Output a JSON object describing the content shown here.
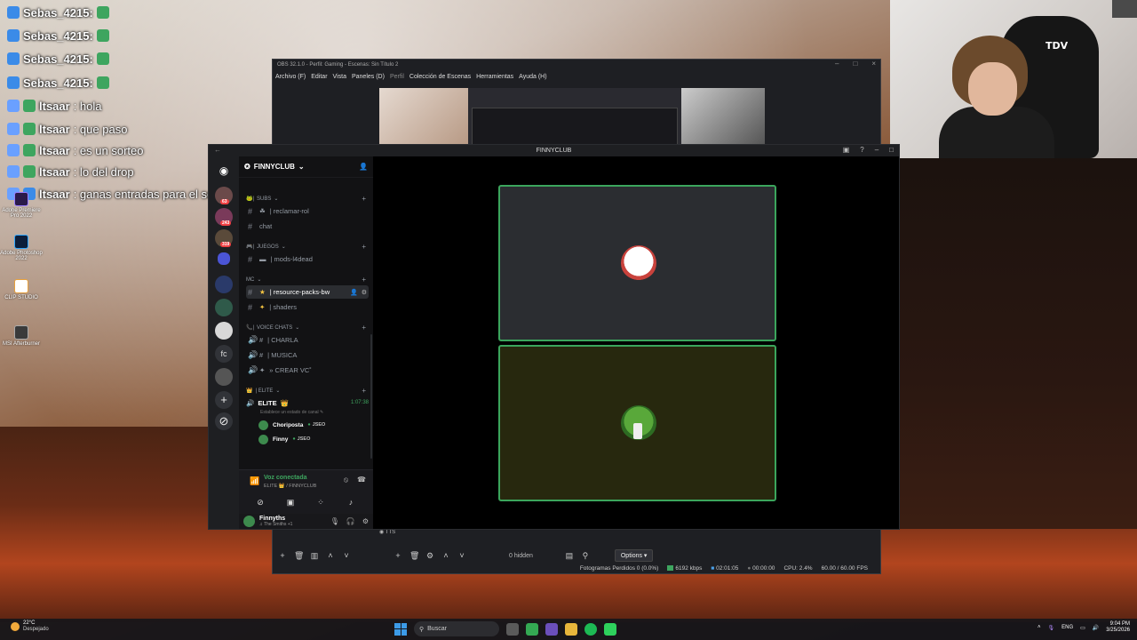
{
  "chat": [
    {
      "user": "Sebas_4215:",
      "text": ""
    },
    {
      "user": "Sebas_4215:",
      "text": ""
    },
    {
      "user": "Sebas_4215:",
      "text": ""
    },
    {
      "user": "Sebas_4215:",
      "text": ""
    },
    {
      "user": "ltsaar",
      "text": ": hola"
    },
    {
      "user": "ltsaar",
      "text": ": que paso"
    },
    {
      "user": "ltsaar",
      "text": ": es un sorteo"
    },
    {
      "user": "ltsaar",
      "text": ": lo del drop"
    },
    {
      "user": "ltsaar",
      "text": ": ganas entradas para el sorteo"
    }
  ],
  "desktop_icons": [
    "Adobe Premiere Pro 2022",
    "Adobe Photoshop 2022",
    "CLIP STUDIO",
    "MSI Afterburner"
  ],
  "webcam": {
    "logo": "TDV"
  },
  "obs": {
    "title": "OBS 32.1.0 - Perfil: Gaming - Escenas: Sin Título 2",
    "menu": [
      "Archivo (F)",
      "Editar",
      "Vista",
      "Paneles (D)",
      "Perfil",
      "Colección de Escenas",
      "Herramientas",
      "Ayuda (H)"
    ],
    "source": "TTS",
    "hidden_label": "0 hidden",
    "options_label": "Options",
    "status": {
      "dropped": "Fotogramas Perdidos 0 (0.0%)",
      "bitrate": "6192 kbps",
      "stream_time": "02:01:05",
      "rec_time": "00:00:00",
      "cpu": "CPU: 2.4%",
      "fps": "60.00 / 60.00 FPS"
    }
  },
  "discord": {
    "window_title": "FINNYCLUB",
    "guild_name": "FINNYCLUB",
    "server_badges": [
      "63",
      "243",
      "319"
    ],
    "server_fc": "fc",
    "categories": {
      "subs": "SUBS",
      "juegos": "JUEGOS",
      "mc": "MC",
      "voice": "VOICE CHATS",
      "elite": "| ELITE"
    },
    "channels": {
      "reclamar": "| reclamar-rol",
      "chat": "chat",
      "mods": "| mods-l4dead",
      "resource": "| resource-packs-bw",
      "shaders": "| shaders",
      "charla": "| CHARLA",
      "musica": "| MUSICA",
      "crear": "» CREAR VC˚"
    },
    "voice_channel": {
      "name": "ELITE",
      "timer": "1:07:38",
      "status_placeholder": "Establece un estado de canal",
      "members": [
        {
          "name": "Choriposta",
          "tag": "JSEO"
        },
        {
          "name": "Finny",
          "tag": "JSEO"
        }
      ]
    },
    "voice_panel": {
      "title": "Voz conectada",
      "channel": "ELITE 👑 / FINNYCLUB"
    },
    "user": {
      "name": "Finnyths",
      "status": "The Smiths +1"
    }
  },
  "taskbar": {
    "temp": "22°C",
    "condition": "Despejado",
    "search_placeholder": "Buscar",
    "lang": "ENG",
    "time": "9:04 PM",
    "date": "3/25/2026"
  }
}
